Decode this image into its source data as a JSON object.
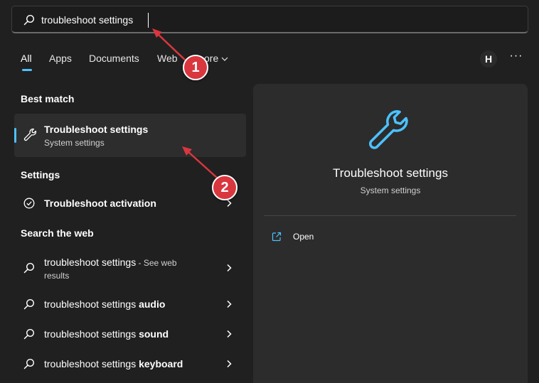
{
  "search": {
    "query": "troubleshoot settings"
  },
  "tabs": [
    {
      "label": "All"
    },
    {
      "label": "Apps"
    },
    {
      "label": "Documents"
    },
    {
      "label": "Web"
    },
    {
      "label": "ore"
    }
  ],
  "account": {
    "initial": "H"
  },
  "more_options_label": "···",
  "best_match": {
    "heading": "Best match",
    "title": "Troubleshoot settings",
    "subtitle": "System settings"
  },
  "settings": {
    "heading": "Settings",
    "item": {
      "label": "Troubleshoot activation"
    }
  },
  "web": {
    "heading": "Search the web",
    "items": [
      {
        "text": "troubleshoot settings",
        "suffix": " - See web",
        "suffix2": "results"
      },
      {
        "text": "troubleshoot settings ",
        "bold": "audio"
      },
      {
        "text": "troubleshoot settings ",
        "bold": "sound"
      },
      {
        "text": "troubleshoot settings ",
        "bold": "keyboard"
      }
    ]
  },
  "preview": {
    "title": "Troubleshoot settings",
    "subtitle": "System settings",
    "action_open": "Open"
  },
  "callouts": [
    "1",
    "2"
  ],
  "colors": {
    "accent": "#4cc2ff",
    "callout": "#d9363e",
    "background": "#202020",
    "panel": "#2c2c2c"
  },
  "icons": [
    "search-icon",
    "wrench-icon",
    "check-circle-icon",
    "chevron-right-icon",
    "open-external-icon",
    "chevron-down-icon"
  ]
}
